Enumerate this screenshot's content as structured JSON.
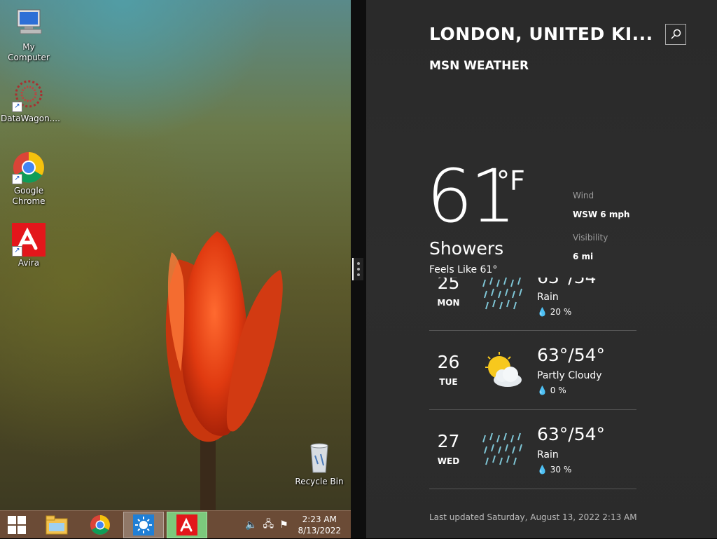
{
  "desktop": {
    "icons": [
      {
        "label": "My Computer"
      },
      {
        "label": "DataWagon...."
      },
      {
        "label": "Google Chrome"
      },
      {
        "label": "Avira"
      },
      {
        "label": "Recycle Bin"
      }
    ]
  },
  "taskbar": {
    "time": "2:23 AM",
    "date": "8/13/2022",
    "pinned": [
      "windows-start",
      "file-explorer",
      "google-chrome",
      "weather",
      "avira"
    ]
  },
  "weather": {
    "location": "LONDON, UNITED KI...",
    "brand": "MSN WEATHER",
    "temperature": "61",
    "unit": "°F",
    "condition": "Showers",
    "feels_like": "Feels Like 61°",
    "wind_label": "Wind",
    "wind_value": "WSW 6 mph",
    "visibility_label": "Visibility",
    "visibility_value": "6 mi",
    "forecast": [
      {
        "date": "25",
        "day": "MON",
        "temps": "63°/54°",
        "condition": "Rain",
        "precip": "20 %"
      },
      {
        "date": "26",
        "day": "TUE",
        "temps": "63°/54°",
        "condition": "Partly Cloudy",
        "precip": "0 %"
      },
      {
        "date": "27",
        "day": "WED",
        "temps": "63°/54°",
        "condition": "Rain",
        "precip": "30 %"
      }
    ],
    "last_updated": "Last updated Saturday, August 13, 2022 2:13 AM"
  }
}
